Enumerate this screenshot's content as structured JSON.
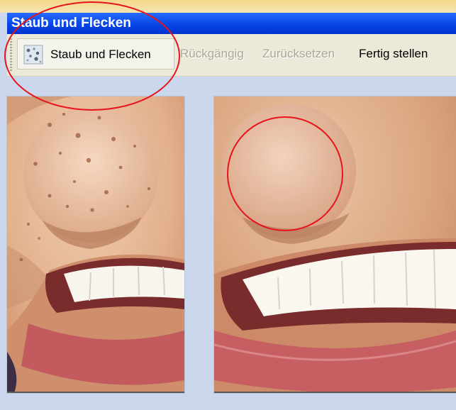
{
  "window": {
    "title": "Staub und Flecken"
  },
  "toolbar": {
    "main_button_label": "Staub und Flecken",
    "main_button_icon": "dust-spots-filter-icon",
    "undo_label": "Rückgängig",
    "reset_label": "Zurücksetzen",
    "finish_label": "Fertig stellen"
  },
  "images": {
    "before": {
      "description_icon": "freckled-face-photo",
      "state": "before"
    },
    "after": {
      "description_icon": "smoothed-face-photo",
      "state": "after"
    }
  },
  "colors": {
    "title_bar": "#0746e6",
    "toolbar_bg": "#ece9d8",
    "workspace_bg": "#cbd7ec",
    "annotation": "#e8141b"
  }
}
